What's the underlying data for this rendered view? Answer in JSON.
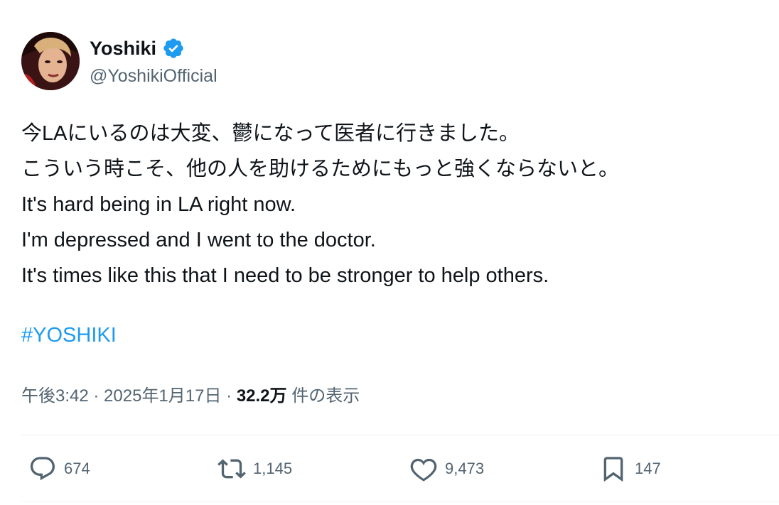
{
  "author": {
    "display_name": "Yoshiki",
    "handle": "@YoshikiOfficial",
    "verified": true,
    "avatar_icon": "profile-photo"
  },
  "tweet": {
    "lines": [
      "今LAにいるのは大変、鬱になって医者に行きました。",
      "こういう時こそ、他の人を助けるためにもっと強くならないと。",
      "It's hard being in LA right now.",
      "I'm depressed and I went to the doctor.",
      "It's times like this that I need to be stronger to help others."
    ],
    "hashtag": "#YOSHIKI"
  },
  "meta": {
    "time": "午後3:42",
    "separator": " · ",
    "date": "2025年1月17日",
    "views_count": "32.2万",
    "views_label": " 件の表示"
  },
  "actions": {
    "reply_count": "674",
    "retweet_count": "1,145",
    "like_count": "9,473",
    "bookmark_count": "147"
  },
  "colors": {
    "accent": "#1d9bf0",
    "secondary_text": "#536471",
    "primary_text": "#0f1419"
  }
}
